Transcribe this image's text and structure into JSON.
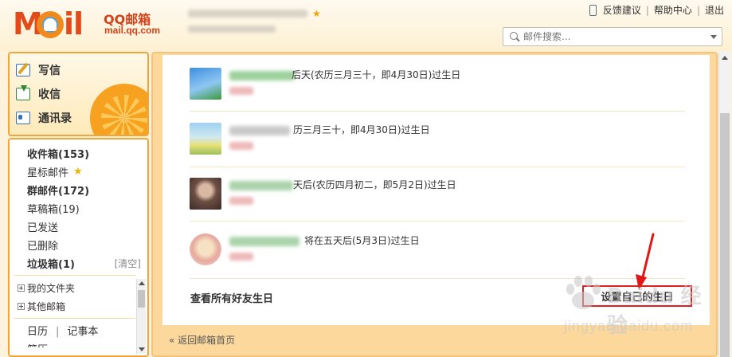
{
  "header": {
    "brand_title": "QQ邮箱",
    "brand_url": "mail.qq.com",
    "top_links": [
      "反馈建议",
      "帮助中心",
      "退出"
    ],
    "search_placeholder": "邮件搜索..."
  },
  "sidebar": {
    "actions": [
      "写信",
      "收信",
      "通讯录"
    ],
    "folders": [
      {
        "label": "收件箱(153)",
        "bold": true
      },
      {
        "label": "星标邮件",
        "bold": false
      },
      {
        "label": "群邮件(172)",
        "bold": true
      },
      {
        "label": "草稿箱(19)",
        "bold": false
      },
      {
        "label": "已发送",
        "bold": false
      },
      {
        "label": "已删除",
        "bold": false
      },
      {
        "label": "垃圾箱(1)",
        "bold": true
      }
    ],
    "clear_label": "[清空]",
    "tree": [
      "我的文件夹",
      "其他邮箱"
    ],
    "bottom_links": [
      "日历",
      "记事本"
    ],
    "cut_off_item": "简历"
  },
  "main": {
    "birthdays": [
      {
        "text": "后天(农历三月三十，即4月30日)过生日"
      },
      {
        "text": "历三月三十，即4月30日)过生日"
      },
      {
        "text": "天后(农历四月初二，即5月2日)过生日"
      },
      {
        "text": "将在五天后(5月3日)过生日"
      }
    ],
    "all_birthdays_link": "查看所有好友生日",
    "set_birthday_button": "设置自己的生日",
    "back_link": "« 返回邮箱首页"
  },
  "watermark": {
    "text": "Baidu 经验",
    "url": "jingyan.baidu.com"
  }
}
